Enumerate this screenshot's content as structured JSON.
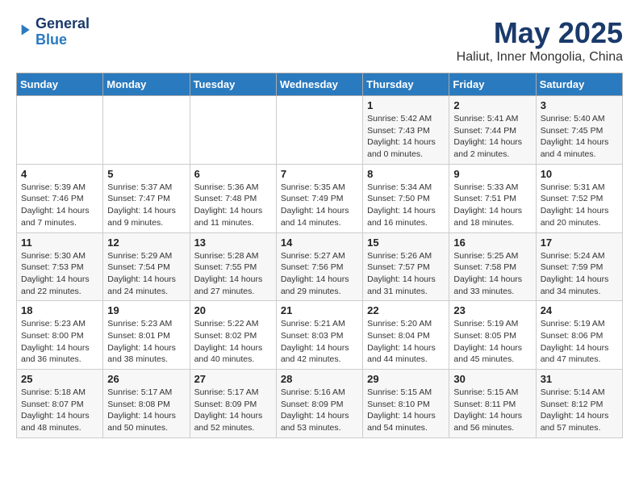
{
  "header": {
    "logo_line1": "General",
    "logo_line2": "Blue",
    "main_title": "May 2025",
    "subtitle": "Haliut, Inner Mongolia, China"
  },
  "days_of_week": [
    "Sunday",
    "Monday",
    "Tuesday",
    "Wednesday",
    "Thursday",
    "Friday",
    "Saturday"
  ],
  "weeks": [
    [
      {
        "num": "",
        "detail": ""
      },
      {
        "num": "",
        "detail": ""
      },
      {
        "num": "",
        "detail": ""
      },
      {
        "num": "",
        "detail": ""
      },
      {
        "num": "1",
        "detail": "Sunrise: 5:42 AM\nSunset: 7:43 PM\nDaylight: 14 hours\nand 0 minutes."
      },
      {
        "num": "2",
        "detail": "Sunrise: 5:41 AM\nSunset: 7:44 PM\nDaylight: 14 hours\nand 2 minutes."
      },
      {
        "num": "3",
        "detail": "Sunrise: 5:40 AM\nSunset: 7:45 PM\nDaylight: 14 hours\nand 4 minutes."
      }
    ],
    [
      {
        "num": "4",
        "detail": "Sunrise: 5:39 AM\nSunset: 7:46 PM\nDaylight: 14 hours\nand 7 minutes."
      },
      {
        "num": "5",
        "detail": "Sunrise: 5:37 AM\nSunset: 7:47 PM\nDaylight: 14 hours\nand 9 minutes."
      },
      {
        "num": "6",
        "detail": "Sunrise: 5:36 AM\nSunset: 7:48 PM\nDaylight: 14 hours\nand 11 minutes."
      },
      {
        "num": "7",
        "detail": "Sunrise: 5:35 AM\nSunset: 7:49 PM\nDaylight: 14 hours\nand 14 minutes."
      },
      {
        "num": "8",
        "detail": "Sunrise: 5:34 AM\nSunset: 7:50 PM\nDaylight: 14 hours\nand 16 minutes."
      },
      {
        "num": "9",
        "detail": "Sunrise: 5:33 AM\nSunset: 7:51 PM\nDaylight: 14 hours\nand 18 minutes."
      },
      {
        "num": "10",
        "detail": "Sunrise: 5:31 AM\nSunset: 7:52 PM\nDaylight: 14 hours\nand 20 minutes."
      }
    ],
    [
      {
        "num": "11",
        "detail": "Sunrise: 5:30 AM\nSunset: 7:53 PM\nDaylight: 14 hours\nand 22 minutes."
      },
      {
        "num": "12",
        "detail": "Sunrise: 5:29 AM\nSunset: 7:54 PM\nDaylight: 14 hours\nand 24 minutes."
      },
      {
        "num": "13",
        "detail": "Sunrise: 5:28 AM\nSunset: 7:55 PM\nDaylight: 14 hours\nand 27 minutes."
      },
      {
        "num": "14",
        "detail": "Sunrise: 5:27 AM\nSunset: 7:56 PM\nDaylight: 14 hours\nand 29 minutes."
      },
      {
        "num": "15",
        "detail": "Sunrise: 5:26 AM\nSunset: 7:57 PM\nDaylight: 14 hours\nand 31 minutes."
      },
      {
        "num": "16",
        "detail": "Sunrise: 5:25 AM\nSunset: 7:58 PM\nDaylight: 14 hours\nand 33 minutes."
      },
      {
        "num": "17",
        "detail": "Sunrise: 5:24 AM\nSunset: 7:59 PM\nDaylight: 14 hours\nand 34 minutes."
      }
    ],
    [
      {
        "num": "18",
        "detail": "Sunrise: 5:23 AM\nSunset: 8:00 PM\nDaylight: 14 hours\nand 36 minutes."
      },
      {
        "num": "19",
        "detail": "Sunrise: 5:23 AM\nSunset: 8:01 PM\nDaylight: 14 hours\nand 38 minutes."
      },
      {
        "num": "20",
        "detail": "Sunrise: 5:22 AM\nSunset: 8:02 PM\nDaylight: 14 hours\nand 40 minutes."
      },
      {
        "num": "21",
        "detail": "Sunrise: 5:21 AM\nSunset: 8:03 PM\nDaylight: 14 hours\nand 42 minutes."
      },
      {
        "num": "22",
        "detail": "Sunrise: 5:20 AM\nSunset: 8:04 PM\nDaylight: 14 hours\nand 44 minutes."
      },
      {
        "num": "23",
        "detail": "Sunrise: 5:19 AM\nSunset: 8:05 PM\nDaylight: 14 hours\nand 45 minutes."
      },
      {
        "num": "24",
        "detail": "Sunrise: 5:19 AM\nSunset: 8:06 PM\nDaylight: 14 hours\nand 47 minutes."
      }
    ],
    [
      {
        "num": "25",
        "detail": "Sunrise: 5:18 AM\nSunset: 8:07 PM\nDaylight: 14 hours\nand 48 minutes."
      },
      {
        "num": "26",
        "detail": "Sunrise: 5:17 AM\nSunset: 8:08 PM\nDaylight: 14 hours\nand 50 minutes."
      },
      {
        "num": "27",
        "detail": "Sunrise: 5:17 AM\nSunset: 8:09 PM\nDaylight: 14 hours\nand 52 minutes."
      },
      {
        "num": "28",
        "detail": "Sunrise: 5:16 AM\nSunset: 8:09 PM\nDaylight: 14 hours\nand 53 minutes."
      },
      {
        "num": "29",
        "detail": "Sunrise: 5:15 AM\nSunset: 8:10 PM\nDaylight: 14 hours\nand 54 minutes."
      },
      {
        "num": "30",
        "detail": "Sunrise: 5:15 AM\nSunset: 8:11 PM\nDaylight: 14 hours\nand 56 minutes."
      },
      {
        "num": "31",
        "detail": "Sunrise: 5:14 AM\nSunset: 8:12 PM\nDaylight: 14 hours\nand 57 minutes."
      }
    ]
  ]
}
